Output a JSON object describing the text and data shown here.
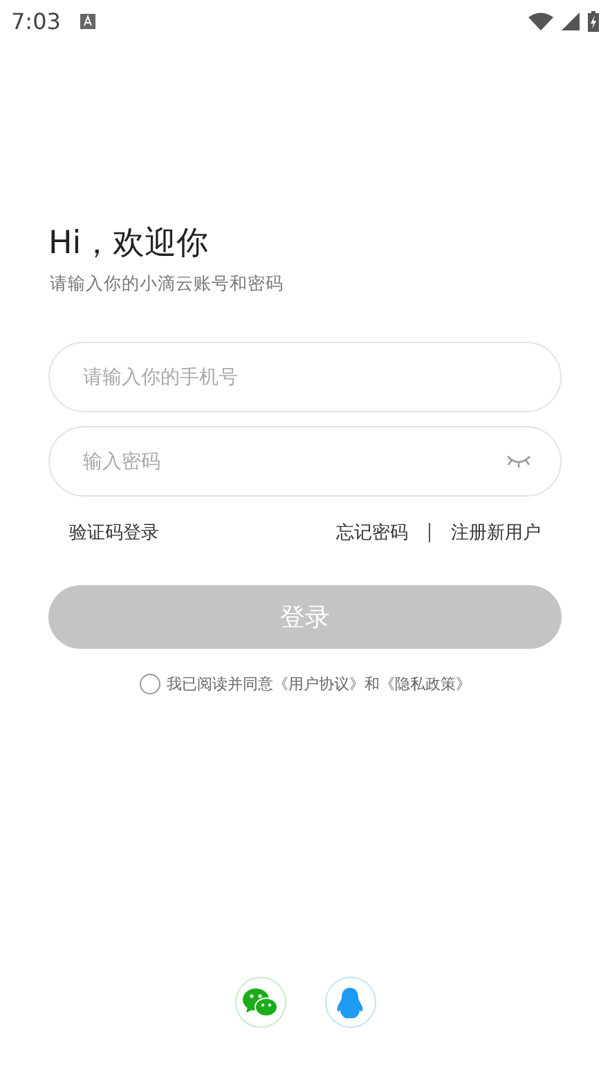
{
  "status_bar": {
    "time": "7:03"
  },
  "greeting": {
    "title": "Hi，欢迎你",
    "subtitle": "请输入你的小滴云账号和密码"
  },
  "phone_field": {
    "placeholder": "请输入你的手机号"
  },
  "password_field": {
    "placeholder": "输入密码",
    "visible": false
  },
  "links": {
    "left": "验证码登录",
    "right": [
      "忘记密码",
      "注册新用户"
    ]
  },
  "login_button": {
    "label": "登录",
    "disabled": true
  },
  "agreement": {
    "text": "我已阅读并同意《用户协议》和《隐私政策》",
    "checked": false
  },
  "social": [
    {
      "kind": "wechat"
    },
    {
      "kind": "qq"
    }
  ]
}
